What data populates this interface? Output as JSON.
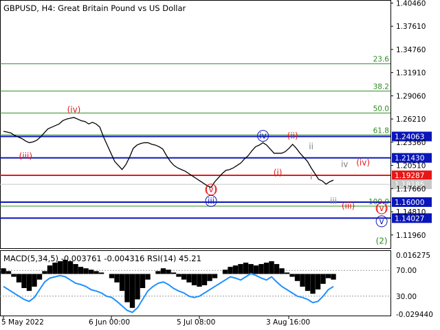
{
  "chart_data": [
    {
      "type": "line",
      "title": "GBPUSD, H4:  Great Britain Pound vs US Dollar",
      "symbol": "GBPUSD",
      "timeframe": "H4",
      "description": "Great Britain Pound vs US Dollar",
      "x_tick_labels": [
        "5 May 2022",
        "6 Jun 00:00",
        "5 Jul 08:00",
        "3 Aug 16:00"
      ],
      "y_tick_labels": [
        "1.40460",
        "1.37610",
        "1.34760",
        "1.31910",
        "1.29060",
        "1.26210",
        "1.23360",
        "1.20510",
        "1.17660",
        "1.14810",
        "1.11960"
      ],
      "ylim": [
        1.1025,
        1.4075
      ],
      "grid": false,
      "series": [
        {
          "values": [
            1.247,
            1.246,
            1.245,
            1.242,
            1.24,
            1.238,
            1.235,
            1.233,
            1.234,
            1.236,
            1.24,
            1.245,
            1.25,
            1.252,
            1.254,
            1.256,
            1.26,
            1.262,
            1.263,
            1.264,
            1.262,
            1.26,
            1.259,
            1.256,
            1.258,
            1.256,
            1.252,
            1.24,
            1.23,
            1.22,
            1.21,
            1.205,
            1.2,
            1.206,
            1.215,
            1.226,
            1.23,
            1.232,
            1.233,
            1.233,
            1.231,
            1.23,
            1.228,
            1.225,
            1.217,
            1.21,
            1.205,
            1.202,
            1.2,
            1.198,
            1.195,
            1.192,
            1.189,
            1.186,
            1.183,
            1.18,
            1.178,
            1.185,
            1.19,
            1.195,
            1.199,
            1.2,
            1.202,
            1.205,
            1.208,
            1.213,
            1.217,
            1.223,
            1.228,
            1.23,
            1.233,
            1.23,
            1.225,
            1.22,
            1.22,
            1.22,
            1.222,
            1.226,
            1.231,
            1.226,
            1.22,
            1.215,
            1.21,
            1.202,
            1.195,
            1.188,
            1.186,
            1.182,
            1.185,
            1.187
          ],
          "color": "#000000"
        }
      ],
      "horizontal_levels": [
        {
          "label": "1.24063",
          "value": 1.24063,
          "color": "#0a16b8",
          "label_bg": "#0a16b8"
        },
        {
          "label": "1.21430",
          "value": 1.2143,
          "color": "#0a16b8",
          "label_bg": "#0a16b8"
        },
        {
          "label": "1.19287",
          "value": 1.19287,
          "color": "#e81717",
          "label_bg": "#e81717"
        },
        {
          "label": "1.18185",
          "value": 1.18185,
          "color": "#c8c8c8",
          "label_bg": "#c8c8c8"
        },
        {
          "label": "1.16000",
          "value": 1.16,
          "color": "#0a16b8",
          "label_bg": "#0a16b8"
        },
        {
          "label": "1.14027",
          "value": 1.14027,
          "color": "#0a16b8",
          "label_bg": "#0a16b8"
        }
      ],
      "fibonacci_levels": [
        {
          "label": "23.6",
          "value": 1.33
        },
        {
          "label": "38.2",
          "value": 1.2965
        },
        {
          "label": "50.0",
          "value": 1.2695
        },
        {
          "label": "61.8",
          "value": 1.2425
        },
        {
          "label": "100.0",
          "value": 1.155
        }
      ],
      "wave_labels": [
        {
          "text": "(iv)",
          "color": "#e81717",
          "circled": false,
          "x_index": 19,
          "value": 1.27
        },
        {
          "text": "(iii)",
          "color": "#e81717",
          "circled": false,
          "x_index": 6,
          "value": 1.213
        },
        {
          "text": "(v)",
          "color": "#e81717",
          "circled": true,
          "x_index": 56,
          "value": 1.172
        },
        {
          "text": "iii",
          "color": "#0a16b8",
          "circled": true,
          "x_index": 56,
          "value": 1.158
        },
        {
          "text": "iv",
          "color": "#0a16b8",
          "circled": true,
          "x_index": 70,
          "value": 1.238
        },
        {
          "text": "(ii)",
          "color": "#e81717",
          "circled": false,
          "x_index": 78,
          "value": 1.238
        },
        {
          "text": "ii",
          "color": "#808080",
          "circled": false,
          "x_index": 83,
          "value": 1.225
        },
        {
          "text": "(i)",
          "color": "#e81717",
          "circled": false,
          "x_index": 74,
          "value": 1.193
        },
        {
          "text": "i",
          "color": "#808080",
          "circled": false,
          "x_index": 83,
          "value": 1.188
        },
        {
          "text": "iv",
          "color": "#808080",
          "circled": false,
          "x_index": 92,
          "value": 1.203
        },
        {
          "text": "(iv)",
          "color": "#e81717",
          "circled": false,
          "x_index": 97,
          "value": 1.205
        },
        {
          "text": "iii",
          "color": "#808080",
          "circled": false,
          "x_index": 89,
          "value": 1.158
        },
        {
          "text": "(iii)",
          "color": "#e81717",
          "circled": false,
          "x_index": 93,
          "value": 1.152
        },
        {
          "text": "(v)",
          "color": "#e81717",
          "circled": true,
          "x_index": 102,
          "value": 1.149
        },
        {
          "text": "v",
          "color": "#0a16b8",
          "circled": true,
          "x_index": 102,
          "value": 1.133
        },
        {
          "text": "(2)",
          "color": "#2e8b22",
          "circled": false,
          "x_index": 102,
          "value": 1.109
        }
      ]
    },
    {
      "type": "bar",
      "title": "MACD(5,34,5) -0.003761 -0.004316 RSI(14) 45.21",
      "indicators": [
        {
          "name": "MACD(5,34,5)",
          "values": [
            "-0.003761",
            "-0.004316"
          ]
        },
        {
          "name": "RSI(14)",
          "values": [
            "45.21"
          ]
        }
      ],
      "y_tick_labels": [
        "0.016275",
        "70.00",
        "30.00",
        "-0.029440"
      ],
      "ylim": [
        -0.02944,
        0.016275
      ],
      "rsi_levels": [
        70,
        30
      ],
      "macd_values": [
        0.004,
        0.002,
        -0.002,
        -0.006,
        -0.01,
        -0.012,
        -0.009,
        -0.004,
        0.002,
        0.006,
        0.008,
        0.009,
        0.01,
        0.009,
        0.007,
        0.005,
        0.004,
        0.003,
        0.002,
        0.001,
        0.0,
        -0.003,
        -0.006,
        -0.012,
        -0.02,
        -0.024,
        -0.018,
        -0.01,
        -0.004,
        0.0,
        0.002,
        0.004,
        0.003,
        0.001,
        -0.002,
        -0.004,
        -0.006,
        -0.008,
        -0.009,
        -0.008,
        -0.005,
        -0.003,
        0.0,
        0.003,
        0.005,
        0.006,
        0.007,
        0.008,
        0.007,
        0.006,
        0.007,
        0.008,
        0.009,
        0.007,
        0.004,
        0.001,
        -0.002,
        -0.005,
        -0.009,
        -0.012,
        -0.014,
        -0.011,
        -0.007,
        -0.003,
        -0.004
      ],
      "rsi_values": [
        45,
        40,
        35,
        30,
        25,
        22,
        28,
        40,
        52,
        58,
        60,
        62,
        60,
        55,
        50,
        48,
        45,
        40,
        38,
        35,
        30,
        28,
        22,
        15,
        8,
        5,
        12,
        25,
        38,
        45,
        50,
        52,
        48,
        42,
        38,
        35,
        30,
        28,
        30,
        35,
        40,
        45,
        50,
        55,
        60,
        58,
        55,
        60,
        65,
        62,
        58,
        55,
        60,
        52,
        45,
        40,
        35,
        30,
        28,
        25,
        20,
        22,
        30,
        40,
        45
      ],
      "series": [
        {
          "name": "MACD histogram",
          "color": "#000000"
        },
        {
          "name": "RSI(14)",
          "color": "#1e90ff"
        }
      ]
    }
  ],
  "time_axis_labels": [
    "5 May 2022",
    "6 Jun 00:00",
    "5 Jul 08:00",
    "3 Aug 16:00"
  ]
}
